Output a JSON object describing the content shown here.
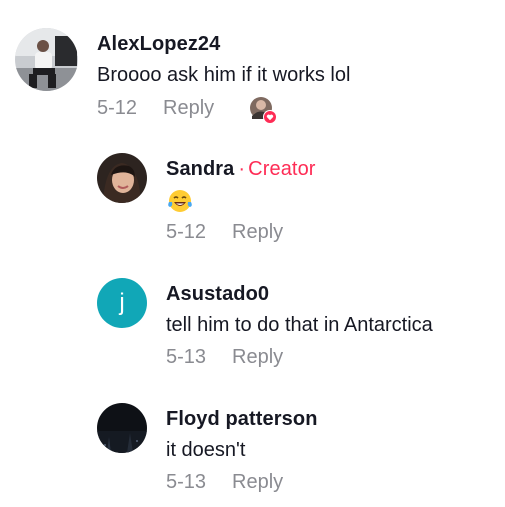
{
  "comments": [
    {
      "username": "AlexLopez24",
      "text": "Broooo ask him if it works lol",
      "date": "5-12",
      "reply_label": "Reply"
    },
    {
      "username": "Sandra",
      "creator_label": "Creator",
      "text": "😂",
      "date": "5-12",
      "reply_label": "Reply"
    },
    {
      "username": "Asustado0",
      "avatar_letter": "j",
      "text": "tell him to do that in Antarctica",
      "date": "5-13",
      "reply_label": "Reply"
    },
    {
      "username": "Floyd patterson",
      "text": "it doesn't",
      "date": "5-13",
      "reply_label": "Reply"
    }
  ],
  "colors": {
    "creator": "#fe2c55",
    "meta": "#8a8b91",
    "avatar_letter_bg": "#11a7b7",
    "heart": "#fe2c55"
  },
  "icons": {
    "creator_liked": "heart-icon",
    "emoji": "face-with-tears-of-joy"
  }
}
